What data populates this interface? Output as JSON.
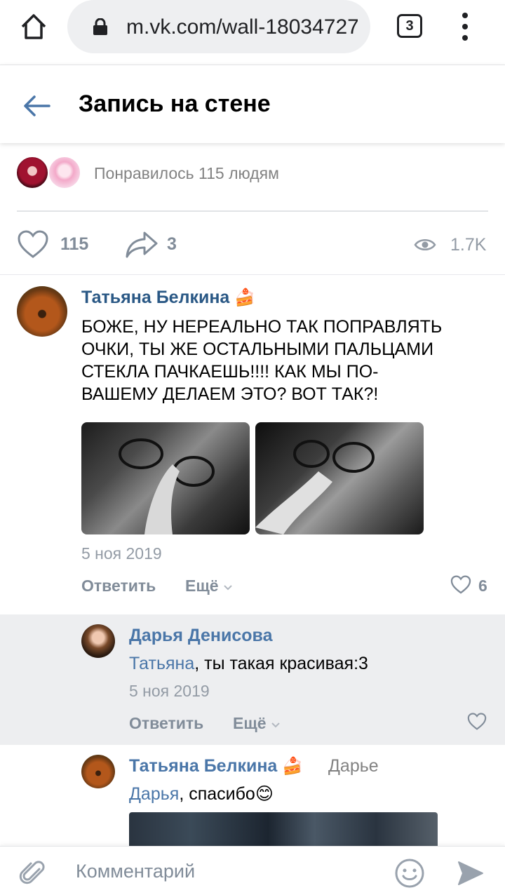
{
  "browser": {
    "url": "m.vk.com/wall-18034727(",
    "tab_count": "3"
  },
  "header": {
    "title": "Запись на стене"
  },
  "likes": {
    "summary": "Понравилось 115 людям"
  },
  "actions": {
    "likes_count": "115",
    "shares_count": "3",
    "views_count": "1.7K"
  },
  "comments": [
    {
      "author": "Татьяна Белкина",
      "author_emoji": "🍰",
      "text": "БОЖЕ, НУ НЕРЕАЛЬНО ТАК ПОПРАВЛЯТЬ ОЧКИ, ТЫ ЖЕ ОСТАЛЬНЫМИ ПАЛЬЦАМИ СТЕКЛА ПАЧКАЕШЬ!!!! КАК МЫ ПО-ВАШЕМУ ДЕЛАЕМ ЭТО? ВОТ ТАК?!",
      "text_lines": [
        "БОЖЕ, НУ НЕРЕАЛЬНО ТАК ПОПРАВЛЯТЬ",
        "ОЧКИ, ТЫ ЖЕ ОСТАЛЬНЫМИ ПАЛЬЦАМИ",
        "СТЕКЛА ПАЧКАЕШЬ!!!! КАК МЫ ПО-",
        "ВАШЕМУ ДЕЛАЕМ ЭТО? ВОТ ТАК?!"
      ],
      "date": "5 ноя 2019",
      "reply_label": "Ответить",
      "more_label": "Ещё",
      "like_count": "6"
    },
    {
      "author": "Дарья Денисова",
      "mention": "Татьяна",
      "text": ", ты такая красивая:3",
      "date": "5 ноя 2019",
      "reply_label": "Ответить",
      "more_label": "Ещё"
    },
    {
      "author": "Татьяна Белкина",
      "author_emoji": "🍰",
      "reply_to": "Дарье",
      "mention": "Дарья",
      "text": ", спасибо",
      "text_emoji": "😊"
    }
  ],
  "composer": {
    "placeholder": "Комментарий"
  },
  "colors": {
    "link_blue": "#4a76a8",
    "name_blue": "#2a5885",
    "muted_gray": "#818c99",
    "nested_bg": "#edeef0"
  }
}
